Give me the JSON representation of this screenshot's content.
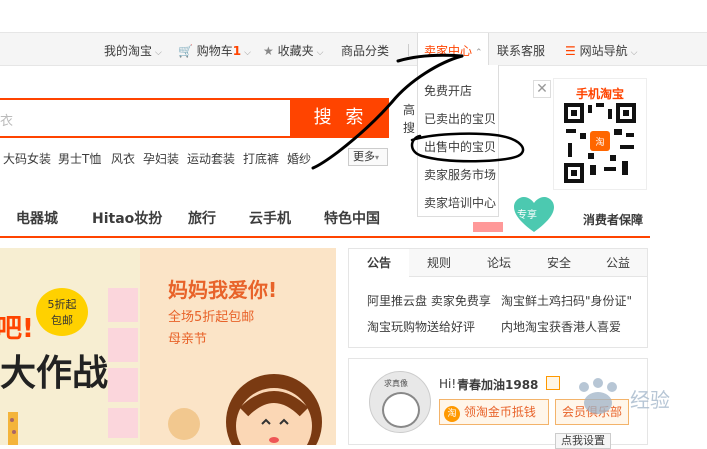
{
  "topbar": {
    "my_taobao": "我的淘宝",
    "cart": "购物车",
    "cart_count": "1",
    "favorites": "收藏夹",
    "categories": "商品分类",
    "seller_center": "卖家中心",
    "customer_service": "联系客服",
    "site_nav": "网站导航"
  },
  "dropdown": {
    "items": [
      "免费开店",
      "已卖出的宝贝",
      "出售中的宝贝",
      "卖家服务市场",
      "卖家培训中心"
    ]
  },
  "search": {
    "placeholder": "衣",
    "button": "搜 索",
    "hot_words": [
      "大码女装",
      "男士T恤",
      "风衣",
      "孕妇装",
      "运动套装",
      "打底裤",
      "婚纱"
    ],
    "more": "更多",
    "side_text_1": "高",
    "side_text_2": "搜"
  },
  "qr": {
    "title": "手机淘宝"
  },
  "nav": {
    "items": [
      "电器城",
      "Hitao妆扮",
      "旅行",
      "云手机",
      "特色中国"
    ],
    "badge": "专享",
    "protection": "消费者保障"
  },
  "banner": {
    "heading": "妈妈我爱你!",
    "sub1": "全场5折起包邮",
    "sub2": "母亲节",
    "big_text": "大作战",
    "tag_top": "5折起",
    "tag_bottom": "包邮",
    "left_char": "吧!"
  },
  "notice": {
    "tabs": [
      "公告",
      "规则",
      "论坛",
      "安全",
      "公益"
    ],
    "items": [
      "阿里推云盘 卖家免费享",
      "淘宝鲜土鸡扫码\"身份证\"",
      "淘宝玩购物送给好评",
      "内地淘宝获香港人喜爱"
    ]
  },
  "user": {
    "greeting": "Hi!",
    "name": "青春加油1988",
    "coin_btn": "领淘金币抵钱",
    "club_btn": "会员俱乐部",
    "settings": "点我设置",
    "avatar_label": "求真像"
  },
  "colors": {
    "accent": "#ff4400",
    "dropdown_highlight": "#ff4400"
  }
}
